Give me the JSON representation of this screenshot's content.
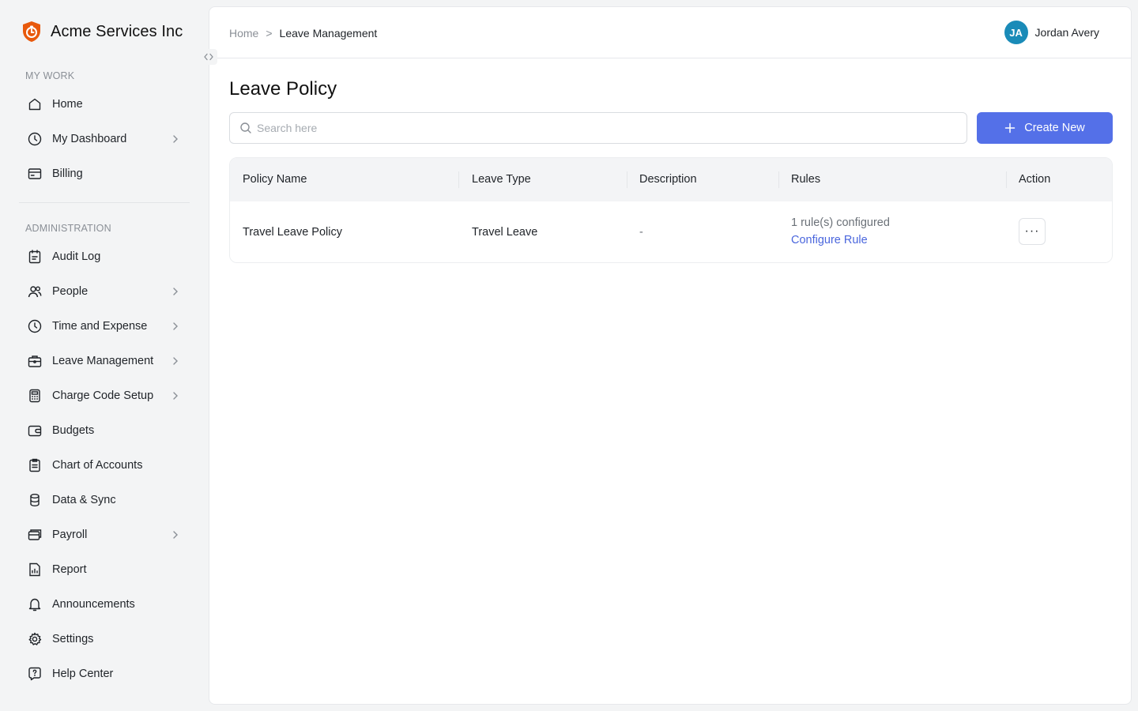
{
  "brand": {
    "name": "Acme Services Inc",
    "logo_color": "#e8590c"
  },
  "sidebar": {
    "sections": [
      {
        "label": "MY WORK"
      },
      {
        "label": "ADMINISTRATION"
      }
    ],
    "my_work": [
      {
        "label": "Home",
        "icon": "home-icon",
        "chevron": false
      },
      {
        "label": "My Dashboard",
        "icon": "clock-icon",
        "chevron": true
      },
      {
        "label": "Billing",
        "icon": "billing-icon",
        "chevron": false
      }
    ],
    "admin": [
      {
        "label": "Audit Log",
        "icon": "audit-log-icon",
        "chevron": false
      },
      {
        "label": "People",
        "icon": "people-icon",
        "chevron": true
      },
      {
        "label": "Time and Expense",
        "icon": "clock-icon",
        "chevron": true
      },
      {
        "label": "Leave Management",
        "icon": "briefcase-icon",
        "chevron": true
      },
      {
        "label": "Charge Code Setup",
        "icon": "calculator-icon",
        "chevron": true
      },
      {
        "label": "Budgets",
        "icon": "wallet-icon",
        "chevron": false
      },
      {
        "label": "Chart of Accounts",
        "icon": "clipboard-icon",
        "chevron": false
      },
      {
        "label": "Data & Sync",
        "icon": "database-icon",
        "chevron": false
      },
      {
        "label": "Payroll",
        "icon": "payroll-icon",
        "chevron": true
      },
      {
        "label": "Report",
        "icon": "report-icon",
        "chevron": false
      },
      {
        "label": "Announcements",
        "icon": "bell-icon",
        "chevron": false
      },
      {
        "label": "Settings",
        "icon": "gear-icon",
        "chevron": false
      },
      {
        "label": "Help Center",
        "icon": "help-icon",
        "chevron": false
      }
    ]
  },
  "header": {
    "breadcrumb": {
      "home": "Home",
      "separator": ">",
      "current": "Leave Management"
    },
    "user": {
      "initials": "JA",
      "name": "Jordan Avery",
      "avatar_color": "#1a8bb8"
    }
  },
  "main": {
    "title": "Leave Policy",
    "search": {
      "placeholder": "Search here",
      "value": ""
    },
    "create_button": "Create New",
    "accent_color": "#5470e8",
    "table": {
      "columns": [
        "Policy Name",
        "Leave Type",
        "Description",
        "Rules",
        "Action"
      ],
      "rows": [
        {
          "policy_name": "Travel Leave Policy",
          "leave_type": "Travel Leave",
          "description": "-",
          "rules_count": "1 rule(s) configured",
          "rules_link": "Configure Rule",
          "action": "···"
        }
      ]
    }
  }
}
